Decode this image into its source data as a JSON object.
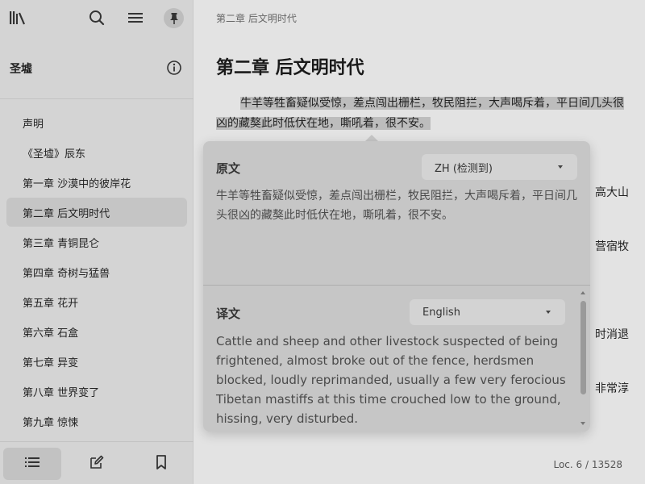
{
  "sidebar": {
    "book_title": "圣墟",
    "toc": [
      {
        "label": "声明"
      },
      {
        "label": "《圣墟》辰东"
      },
      {
        "label": "第一章 沙漠中的彼岸花"
      },
      {
        "label": "第二章 后文明时代",
        "active": true
      },
      {
        "label": "第三章 青铜昆仑"
      },
      {
        "label": "第四章 奇树与猛兽"
      },
      {
        "label": "第五章 花开"
      },
      {
        "label": "第六章 石盒"
      },
      {
        "label": "第七章 异变"
      },
      {
        "label": "第八章 世界变了"
      },
      {
        "label": "第九章 惊悚"
      }
    ],
    "icons": {
      "library": "library-icon",
      "search": "search-icon",
      "menu": "menu-icon",
      "pin": "pin-icon",
      "info": "info-icon",
      "toc": "list-icon",
      "notes": "edit-icon",
      "bookmark": "bookmark-icon"
    }
  },
  "reader": {
    "breadcrumb": "第二章 后文明时代",
    "chapter_title": "第二章 后文明时代",
    "paragraph": "牛羊等牲畜疑似受惊，差点闯出栅栏，牧民阻拦，大声喝斥着，平日间几头很凶的藏獒此时低伏在地，嘶吼着，很不安。",
    "peek_fragments": [
      "高大山",
      "营宿牧",
      "时消退",
      "非常淳"
    ],
    "location": "Loc. 6 / 13528"
  },
  "translate_popup": {
    "source_label": "原文",
    "source_lang": "ZH (检测到)",
    "source_text": "牛羊等牲畜疑似受惊，差点闯出栅栏，牧民阻拦，大声喝斥着，平日间几头很凶的藏獒此时低伏在地，嘶吼着，很不安。",
    "target_label": "译文",
    "target_lang": "English",
    "target_text": "Cattle and sheep and other livestock suspected of being frightened, almost broke out of the fence, herdsmen blocked, loudly reprimanded, usually a few very ferocious Tibetan mastiffs at this time crouched low to the ground, hissing, very disturbed."
  },
  "colors": {
    "sidebar_bg": "#d4d4d4",
    "reader_bg": "#e3e3e3",
    "popup_bg": "#c6c6c6",
    "highlight": "#bdbdbd"
  }
}
